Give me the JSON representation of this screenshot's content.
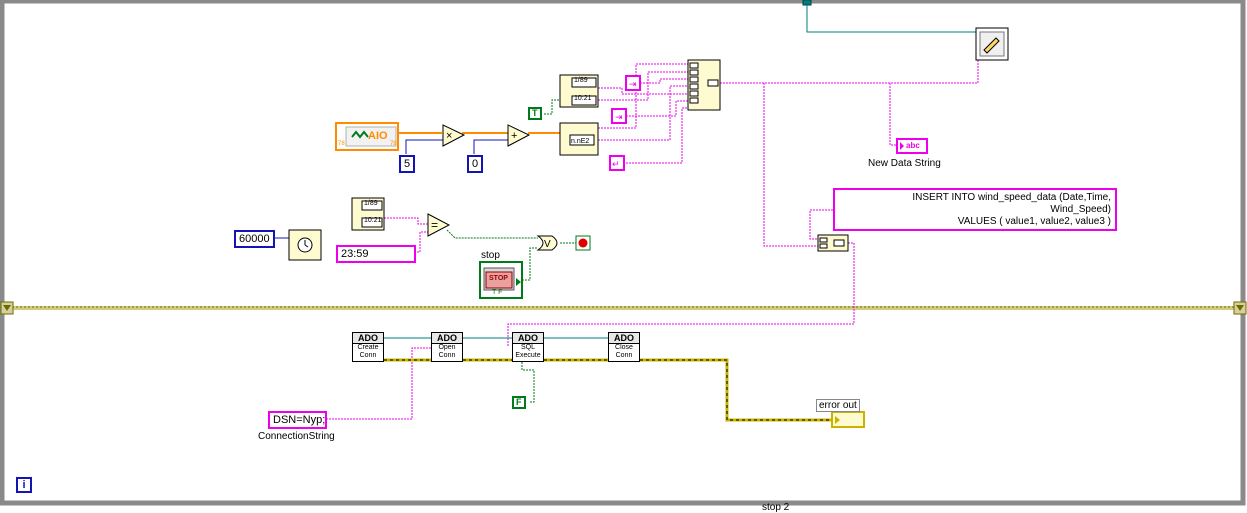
{
  "constants": {
    "five": "5",
    "zero": "0",
    "wait_ms": "60000",
    "time_compare": "23:59",
    "bool_true": "T",
    "bool_false": "F",
    "connection_string": "DSN=Nyp;"
  },
  "labels": {
    "new_data_string": "New Data String",
    "stop": "stop",
    "connection_string": "ConnectionString",
    "error_out": "error out",
    "stop_bottom": "stop 2",
    "info": "i",
    "aio": "AIO",
    "stop_button": "STOP",
    "stop_tf": "T F",
    "abc": "abc"
  },
  "sql": {
    "line1": "INSERT INTO wind_speed_data (Date,Time,",
    "line2": "Wind_Speed)",
    "line3": "VALUES ( value1, value2, value3 )"
  },
  "date_time_node": {
    "date": "1/89",
    "time": "10:21"
  },
  "ado_nodes": [
    {
      "head": "ADO",
      "sub1": "Create",
      "sub2": "Conn"
    },
    {
      "head": "ADO",
      "sub1": "Open",
      "sub2": "Conn"
    },
    {
      "head": "ADO",
      "sub1": "SQL",
      "sub2": "Execute"
    },
    {
      "head": "ADO",
      "sub1": "Close",
      "sub2": "Conn"
    }
  ],
  "colors": {
    "string_wire": "#ee00ee",
    "numeric_wire": "#ff8c00",
    "int_wire": "#1414b4",
    "bool_wire": "#007a1a",
    "error_wire": "#c8b400",
    "refnum_wire": "#007f7f",
    "loop_border": "#888888"
  }
}
